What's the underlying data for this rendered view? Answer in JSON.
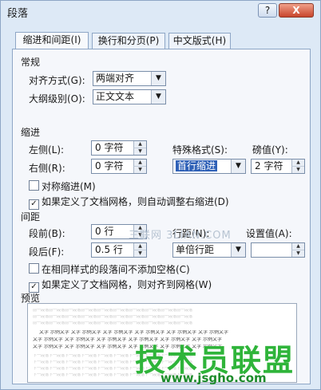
{
  "window": {
    "title": "段落",
    "help_label": "?",
    "close_label": "X"
  },
  "tabs": [
    "缩进和间距(I)",
    "换行和分页(P)",
    "中文版式(H)"
  ],
  "general": {
    "section_label": "常规",
    "alignment_label": "对齐方式(G):",
    "alignment_value": "两端对齐",
    "outline_label": "大纲级别(O):",
    "outline_value": "正文文本"
  },
  "indent": {
    "section_label": "缩进",
    "left_label": "左侧(L):",
    "left_value": "0 字符",
    "right_label": "右侧(R):",
    "right_value": "0 字符",
    "special_label": "特殊格式(S):",
    "special_value": "首行缩进",
    "by_label": "磅值(Y):",
    "by_value": "2 字符",
    "mirror_label": "对称缩进(M)",
    "mirror_checked": false,
    "auto_adjust_label": "如果定义了文档网格，则自动调整右缩进(D)",
    "auto_adjust_checked": true
  },
  "spacing": {
    "section_label": "间距",
    "before_label": "段前(B):",
    "before_value": "0 行",
    "after_label": "段后(F):",
    "after_value": "0.5 行",
    "line_spacing_label": "行距(N):",
    "line_spacing_value": "单倍行距",
    "at_label": "设置值(A):",
    "no_space_label": "在相同样式的段落间不添加空格(C)",
    "no_space_checked": false,
    "snap_grid_label": "如果定义了文档网格，则对齐到网格(W)",
    "snap_grid_checked": true
  },
  "preview": {
    "section_label": "预览",
    "prev_line": "前一段落前一段落前一段落前一段落前一段落前一段落前一段落前一段落前一段落前一段落",
    "sample_line": "文字 示例文字 文字 示例文字 文字 示例文字 文字 示例文字 文字 示例文字 文字 示例文字",
    "next_line": "下一段落下一段落下一段落下一段落下一段落下一段落下一段落下一段落下一段落下一段落"
  },
  "watermarks": {
    "middle": "三联网 3LIAN.COM",
    "brand": "技术员联盟",
    "url": "www.jsgho.com"
  }
}
